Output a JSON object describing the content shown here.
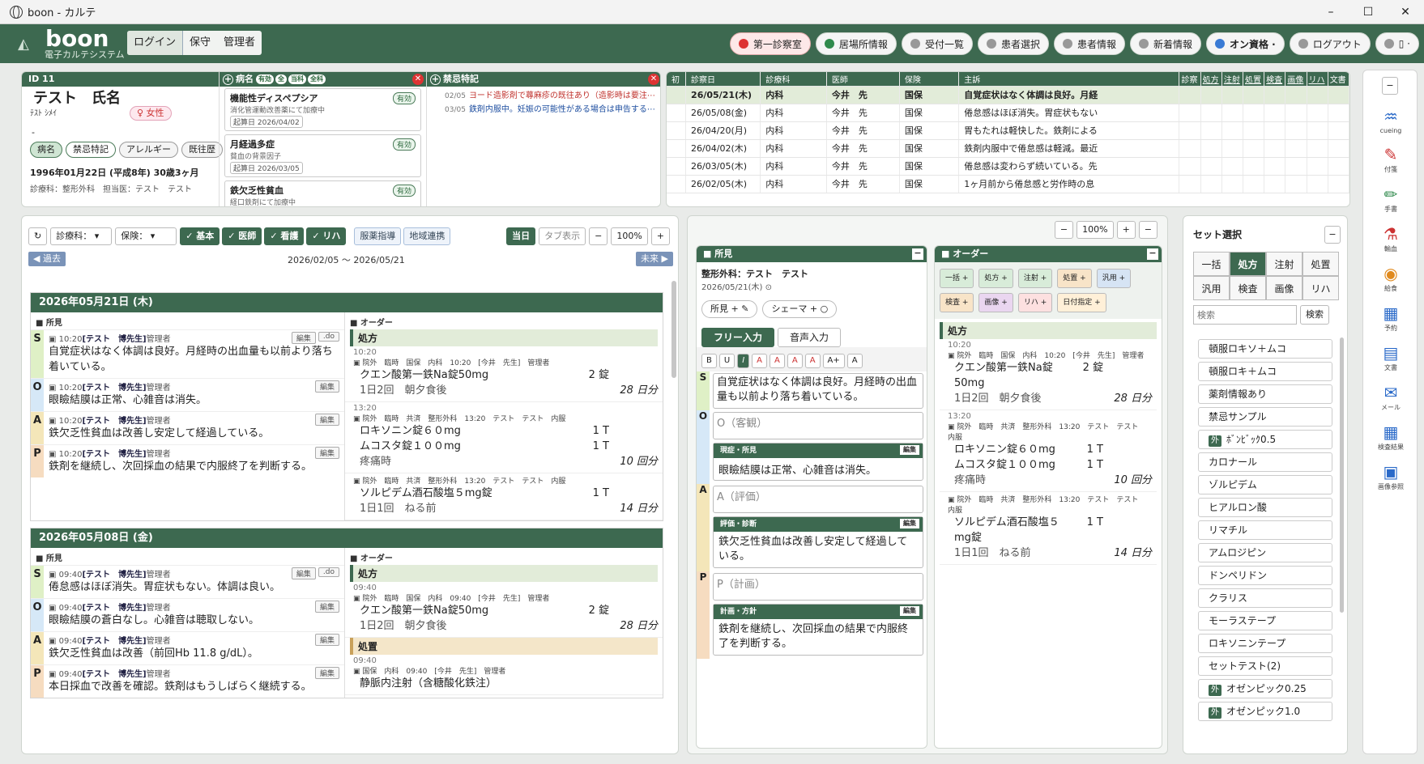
{
  "window": {
    "title": "boon - カルテ",
    "min": "–",
    "max": "☐",
    "close": "✕"
  },
  "brand": {
    "name": "boon",
    "subtitle": "電子カルテシステム"
  },
  "auth": {
    "login": "ログイン",
    "user": "保守",
    "role": "管理者"
  },
  "nav": [
    {
      "label": "第一診察室",
      "style": "red"
    },
    {
      "label": "居場所情報",
      "style": "green"
    },
    {
      "label": "受付一覧",
      "style": "gray"
    },
    {
      "label": "患者選択",
      "style": "gray"
    },
    {
      "label": "患者情報",
      "style": "gray"
    },
    {
      "label": "新着情報",
      "style": "gray"
    },
    {
      "label": "オン資格 ·",
      "style": "teal"
    },
    {
      "label": "ログアウト",
      "style": "gray"
    },
    {
      "label": "▯ ·",
      "style": "gray"
    }
  ],
  "patient": {
    "id_label": "ID 11",
    "name": "テスト　氏名",
    "kana": "ﾃｽﾄ ｼﾒｲ",
    "sex": "♀ 女性",
    "dash": "-",
    "tags": [
      "病名",
      "禁忌特記",
      "アレルギー",
      "既往歴"
    ],
    "dob": "1996年01月22日 (平成8年) 30歳3ヶ月",
    "extra": "診療科：整形外科　担当医：テスト　テスト"
  },
  "disease_panel": {
    "title": "病名",
    "badges": [
      "有効",
      "全",
      "当科",
      "全科"
    ],
    "cards": [
      {
        "name": "機能性ディスペプシア",
        "sub": "消化管運動改善薬にて加療中",
        "date": "起算日 2026/04/02",
        "status": "有効"
      },
      {
        "name": "月経過多症",
        "sub": "貧血の背景因子",
        "date": "起算日 2026/03/05",
        "status": "有効"
      },
      {
        "name": "鉄欠乏性貧血",
        "sub": "経口鉄剤にて加療中",
        "date": "",
        "status": "有効"
      }
    ]
  },
  "notes_panel": {
    "title": "禁忌特記",
    "items": [
      {
        "date": "02/05",
        "text": "ヨード造影剤で蕁麻疹の既往あり（造影時は要注⋯",
        "color": "#c0322d"
      },
      {
        "date": "03/05",
        "text": "鉄剤内服中。妊娠の可能性がある場合は申告する⋯",
        "color": "#1f4fa0"
      }
    ]
  },
  "history": {
    "cols": [
      "初",
      "診察日",
      "診療科",
      "医師",
      "保険",
      "主訴"
    ],
    "flagcols": [
      "診察",
      "処方",
      "注射",
      "処置",
      "検査",
      "画像",
      "リハ",
      "文書"
    ],
    "rows": [
      {
        "date": "26/05/21(木)",
        "dept": "内科",
        "doc": "今井　先",
        "ins": "国保",
        "cc": "自覚症状はなく体調は良好。月経"
      },
      {
        "date": "26/05/08(金)",
        "dept": "内科",
        "doc": "今井　先",
        "ins": "国保",
        "cc": "倦怠感はほぼ消失。胃症状もない"
      },
      {
        "date": "26/04/20(月)",
        "dept": "内科",
        "doc": "今井　先",
        "ins": "国保",
        "cc": "胃もたれは軽快した。鉄剤による"
      },
      {
        "date": "26/04/02(木)",
        "dept": "内科",
        "doc": "今井　先",
        "ins": "国保",
        "cc": "鉄剤内服中で倦怠感は軽減。最近"
      },
      {
        "date": "26/03/05(木)",
        "dept": "内科",
        "doc": "今井　先",
        "ins": "国保",
        "cc": "倦怠感は変わらず続いている。先"
      },
      {
        "date": "26/02/05(木)",
        "dept": "内科",
        "doc": "今井　先",
        "ins": "国保",
        "cc": "1ヶ月前から倦怠感と労作時の息"
      }
    ]
  },
  "filters": {
    "dept": "診療科：",
    "ins": "保険：",
    "toggles": [
      "✓ 基本",
      "✓ 医師",
      "✓ 看護",
      "✓ リハ"
    ],
    "links": [
      "服薬指導",
      "地域連携"
    ],
    "today": "当日",
    "tab": "タブ表示",
    "minus": "−",
    "zoom": "100%",
    "plus": "+",
    "past": "◀ 過去",
    "future": "未来 ▶",
    "range": "2026/02/05 ～ 2026/05/21",
    "refresh": "↻"
  },
  "records": [
    {
      "date": "2026年05月21日 (木)",
      "soap": [
        {
          "k": "S",
          "meta": "10:20",
          "who": "[テスト　博先生]",
          "role": "管理者",
          "text": "自覚症状はなく体調は良好。月経時の出血量も以前より落ち着いている。",
          "do": true
        },
        {
          "k": "O",
          "meta": "10:20",
          "who": "[テスト　博先生]",
          "role": "管理者",
          "text": "眼瞼結膜は正常、心雑音は消失。",
          "do": false
        },
        {
          "k": "A",
          "meta": "10:20",
          "who": "[テスト　博先生]",
          "role": "管理者",
          "text": "鉄欠乏性貧血は改善し安定して経過している。",
          "do": false
        },
        {
          "k": "P",
          "meta": "10:20",
          "who": "[テスト　博先生]",
          "role": "管理者",
          "text": "鉄剤を継続し、次回採血の結果で内服終了を判断する。",
          "do": false
        }
      ],
      "orders": [
        {
          "head": "処方",
          "kind": "rx",
          "blocks": [
            {
              "time": "10:20",
              "meta": "院外　臨時　国保　内科　10:20　[今井　先生]　管理者",
              "rows": [
                [
                  "クエン酸第一鉄Na錠50mg",
                  "2 錠",
                  ""
                ],
                [
                  "1日2回　朝夕食後",
                  "",
                  "28 日分"
                ]
              ]
            },
            {
              "time": "13:20",
              "meta": "院外　臨時　共済　整形外科　13:20　テスト　テスト　内服",
              "rows": [
                [
                  "ロキソニン錠６０mg",
                  "1 T",
                  ""
                ],
                [
                  "ムコスタ錠１００mg",
                  "1 T",
                  ""
                ],
                [
                  "疼痛時",
                  "",
                  "10 回分"
                ]
              ]
            },
            {
              "time": "",
              "meta": "院外　臨時　共済　整形外科　13:20　テスト　テスト　内服",
              "rows": [
                [
                  "ソルピデム酒石酸塩５mg錠",
                  "1 T",
                  ""
                ],
                [
                  "1日1回　ねる前",
                  "",
                  "14 日分"
                ]
              ]
            }
          ]
        }
      ]
    },
    {
      "date": "2026年05月08日 (金)",
      "soap": [
        {
          "k": "S",
          "meta": "09:40",
          "who": "[テスト　博先生]",
          "role": "管理者",
          "text": "倦怠感はほぼ消失。胃症状もない。体調は良い。",
          "do": true
        },
        {
          "k": "O",
          "meta": "09:40",
          "who": "[テスト　博先生]",
          "role": "管理者",
          "text": "眼瞼結膜の蒼白なし。心雑音は聴取しない。",
          "do": false
        },
        {
          "k": "A",
          "meta": "09:40",
          "who": "[テスト　博先生]",
          "role": "管理者",
          "text": "鉄欠乏性貧血は改善（前回Hb 11.8 g/dL）。",
          "do": false
        },
        {
          "k": "P",
          "meta": "09:40",
          "who": "[テスト　博先生]",
          "role": "管理者",
          "text": "本日採血で改善を確認。鉄剤はもうしばらく継続する。",
          "do": false
        }
      ],
      "orders": [
        {
          "head": "処方",
          "kind": "rx",
          "blocks": [
            {
              "time": "09:40",
              "meta": "院外　臨時　国保　内科　09:40　[今井　先生]　管理者",
              "rows": [
                [
                  "クエン酸第一鉄Na錠50mg",
                  "2 錠",
                  ""
                ],
                [
                  "1日2回　朝夕食後",
                  "",
                  "28 日分"
                ]
              ]
            }
          ]
        },
        {
          "head": "処置",
          "kind": "tr",
          "blocks": [
            {
              "time": "09:40",
              "meta": "国保　内科　09:40　[今井　先生]　管理者",
              "rows": [
                [
                  "静脈内注射（含糖酸化鉄注）",
                  "",
                  ""
                ]
              ]
            }
          ]
        }
      ]
    }
  ],
  "labels": {
    "shoken": "■ 所見",
    "order": "■ オーダー",
    "edit": "編集",
    "do": ".do"
  },
  "middle": {
    "minus": "−",
    "zoom": "100%",
    "plus": "+",
    "findings_title": "■ 所見",
    "dept_doc": "整形外科：テスト　テスト",
    "date": "2026/05/21(木)",
    "btn_find": "所見 + ✎",
    "btn_schema": "シェーマ + ○",
    "tab_free": "フリー入力",
    "tab_voice": "音声入力",
    "fmt": [
      "B",
      "U",
      "I",
      "A",
      "A",
      "A",
      "A",
      "A+",
      "A"
    ],
    "s_text": "自覚症状はなく体調は良好。月経時の出血量も以前より落ち着いている。",
    "o_placeholder": "O（客観）",
    "a_placeholder": "A（評価）",
    "p_placeholder": "P（計画）",
    "sub_o": "現症・所見",
    "sub_o_text": "眼瞼結膜は正常、心雑音は消失。",
    "sub_a": "評価・診断",
    "sub_a_text": "鉄欠乏性貧血は改善し安定して経過している。",
    "sub_p": "計画・方針",
    "sub_p_text": "鉄剤を継続し、次回採血の結果で内服終了を判断する。"
  },
  "order_panel": {
    "title": "■ オーダー",
    "buttons": [
      "一括",
      "処方",
      "注射",
      "処置",
      "汎用",
      "検査",
      "画像",
      "リハ",
      "日付指定"
    ],
    "head": "処方",
    "blocks": [
      {
        "time": "10:20",
        "meta": "院外　臨時　国保　内科　10:20　[今井　先生]　管理者",
        "rows": [
          [
            "クエン酸第一鉄Na錠50mg",
            "2 錠",
            ""
          ],
          [
            "1日2回　朝夕食後",
            "",
            "28 日分"
          ]
        ]
      },
      {
        "time": "13:20",
        "meta": "院外　臨時　共済　整形外科　13:20　テスト　テスト　内服",
        "rows": [
          [
            "ロキソニン錠６０mg",
            "1 T",
            ""
          ],
          [
            "ムコスタ錠１００mg",
            "1 T",
            ""
          ],
          [
            "疼痛時",
            "",
            "10 回分"
          ]
        ]
      },
      {
        "time": "",
        "meta": "院外　臨時　共済　整形外科　13:20　テスト　テスト　内服",
        "rows": [
          [
            "ソルピデム酒石酸塩５mg錠",
            "1 T",
            ""
          ],
          [
            "1日1回　ねる前",
            "",
            "14 日分"
          ]
        ]
      }
    ]
  },
  "sets": {
    "title": "セット選択",
    "tabs": [
      "一括",
      "処方",
      "注射",
      "処置",
      "汎用",
      "検査",
      "画像",
      "リハ"
    ],
    "active": "処方",
    "search_placeholder": "検索",
    "search_btn": "検索",
    "items": [
      {
        "t": "頓服ロキソ＋ムコ",
        "g": false
      },
      {
        "t": "頓服ロキ＋ムコ",
        "g": false
      },
      {
        "t": "薬剤情報あり",
        "g": false
      },
      {
        "t": "禁忌サンプル",
        "g": false
      },
      {
        "t": "ﾎﾞﾝﾋﾞｯｸ0.5",
        "g": true
      },
      {
        "t": "カロナール",
        "g": false
      },
      {
        "t": "ゾルピデム",
        "g": false
      },
      {
        "t": "ヒアルロン酸",
        "g": false
      },
      {
        "t": "リマチル",
        "g": false
      },
      {
        "t": "アムロジピン",
        "g": false
      },
      {
        "t": "ドンペリドン",
        "g": false
      },
      {
        "t": "クラリス",
        "g": false
      },
      {
        "t": "モーラステープ",
        "g": false
      },
      {
        "t": "ロキソニンテープ",
        "g": false
      },
      {
        "t": "セットテスト(2)",
        "g": false
      },
      {
        "t": "オゼンピック0.25",
        "g": true
      },
      {
        "t": "オゼンピック1.0",
        "g": true
      }
    ],
    "gai": "外"
  },
  "rightbar": [
    {
      "icon": "cueing-icon",
      "glyph": "♒",
      "label": "cueing",
      "color": "#2a6ac9"
    },
    {
      "icon": "bookmark-icon",
      "glyph": "✎",
      "label": "付箋",
      "color": "#c33"
    },
    {
      "icon": "pen-icon",
      "glyph": "✏",
      "label": "手書",
      "color": "#2f8a4c"
    },
    {
      "icon": "blood-icon",
      "glyph": "⚗",
      "label": "輸血",
      "color": "#c33"
    },
    {
      "icon": "meal-icon",
      "glyph": "◉",
      "label": "給食",
      "color": "#e08a1e"
    },
    {
      "icon": "calendar-icon",
      "glyph": "▦",
      "label": "予約",
      "color": "#2a6ac9"
    },
    {
      "icon": "document-icon",
      "glyph": "▤",
      "label": "文書",
      "color": "#2a6ac9"
    },
    {
      "icon": "mail-icon",
      "glyph": "✉",
      "label": "メール",
      "color": "#2a6ac9"
    },
    {
      "icon": "lab-icon",
      "glyph": "▦",
      "label": "検査結果",
      "color": "#2a6ac9"
    },
    {
      "icon": "image-icon",
      "glyph": "▣",
      "label": "画像参照",
      "color": "#2a6ac9"
    }
  ]
}
